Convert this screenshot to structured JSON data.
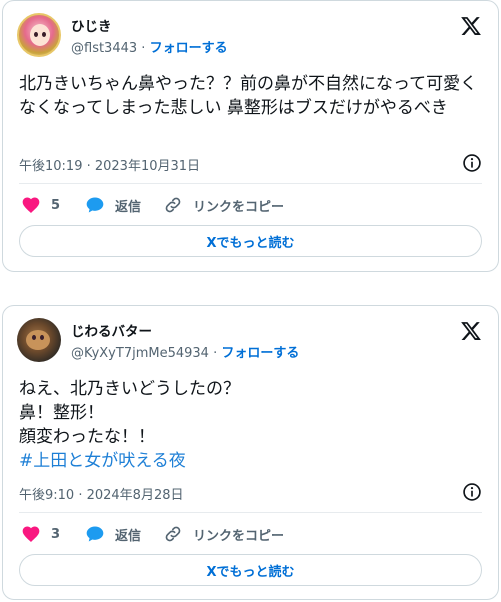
{
  "posts": [
    {
      "name": "ひじき",
      "handle": "@flst3443",
      "separator": " · ",
      "follow_label": "フォローする",
      "text": "北乃きいちゃん鼻やった？？前の鼻が不自然になって可愛くなくなってしまった悲しい 鼻整形はブスだけがやるべき",
      "hashtag": "",
      "timestamp": "午後10:19 · 2023年10月31日",
      "like_count": "5",
      "reply_label": "返信",
      "copy_link_label": "リンクをコピー",
      "read_more_label": "Xでもっと読む",
      "icons": {
        "logo": "x-logo-icon",
        "info": "info-icon",
        "like": "heart-icon",
        "reply": "speech-bubble-icon",
        "copy": "link-icon"
      }
    },
    {
      "name": "じわるバター",
      "handle": "@KyXyT7jmMe54934",
      "separator": " · ",
      "follow_label": "フォローする",
      "text": "ねえ、北乃きいどうしたの？\n鼻！整形！\n顔変わったな！！\n",
      "hashtag": "#上田と女が吠える夜",
      "timestamp": "午後9:10 · 2024年8月28日",
      "like_count": "3",
      "reply_label": "返信",
      "copy_link_label": "リンクをコピー",
      "read_more_label": "Xでもっと読む",
      "icons": {
        "logo": "x-logo-icon",
        "info": "info-icon",
        "like": "heart-icon",
        "reply": "speech-bubble-icon",
        "copy": "link-icon"
      }
    }
  ],
  "colors": {
    "text": "#0f1419",
    "muted": "#536471",
    "link": "#006fd6",
    "like": "#f91880",
    "reply": "#1d9bf0",
    "border": "#cfd9de"
  }
}
